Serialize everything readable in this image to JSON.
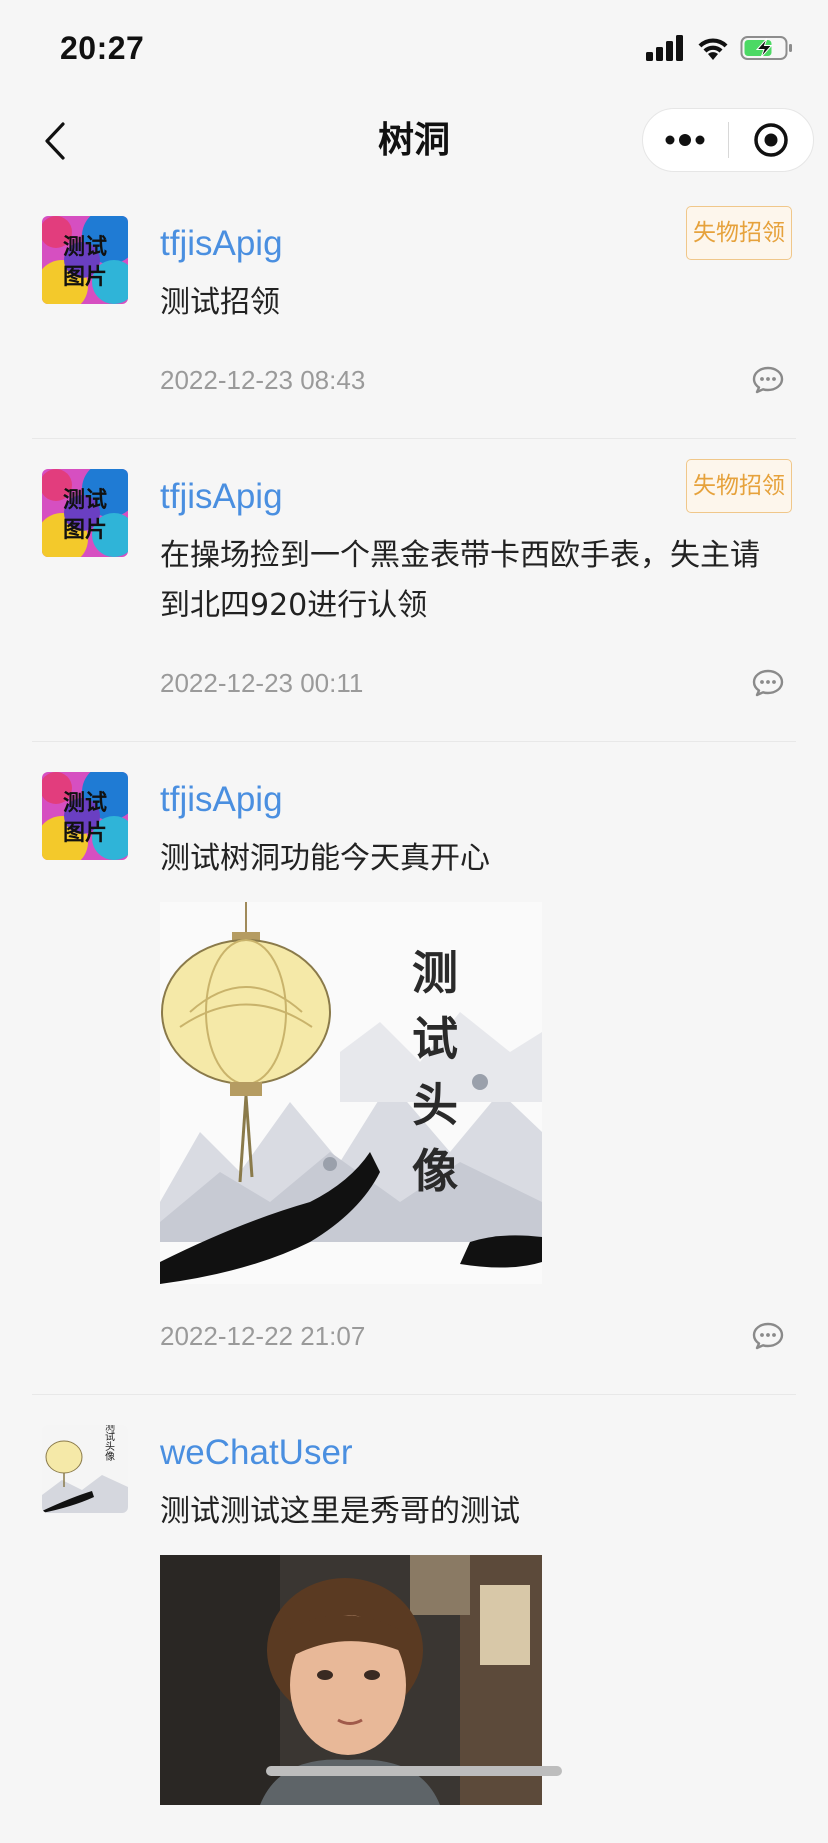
{
  "status_bar": {
    "time": "20:27"
  },
  "nav": {
    "title": "树洞"
  },
  "colors": {
    "author": "#4a8fe0",
    "tag_text": "#e6a23c",
    "tag_bg": "#fdf6ec",
    "date": "#9a9a9a",
    "background": "#f6f6f6"
  },
  "posts": [
    {
      "author": "tfjisApig",
      "content": "测试招领",
      "date": "2022-12-23 08:43",
      "tag": "失物招领",
      "avatar_text": [
        "测试",
        "图片"
      ]
    },
    {
      "author": "tfjisApig",
      "content": "在操场捡到一个黑金表带卡西欧手表，失主请到北四920进行认领",
      "date": "2022-12-23 00:11",
      "tag": "失物招领",
      "avatar_text": [
        "测试",
        "图片"
      ]
    },
    {
      "author": "tfjisApig",
      "content": "测试树洞功能今天真开心",
      "date": "2022-12-22 21:07",
      "image_text": "测试头像",
      "avatar_text": [
        "测试",
        "图片"
      ]
    },
    {
      "author": "weChatUser",
      "content": "测试测试这里是秀哥的测试",
      "avatar_text": "测试头像"
    }
  ]
}
